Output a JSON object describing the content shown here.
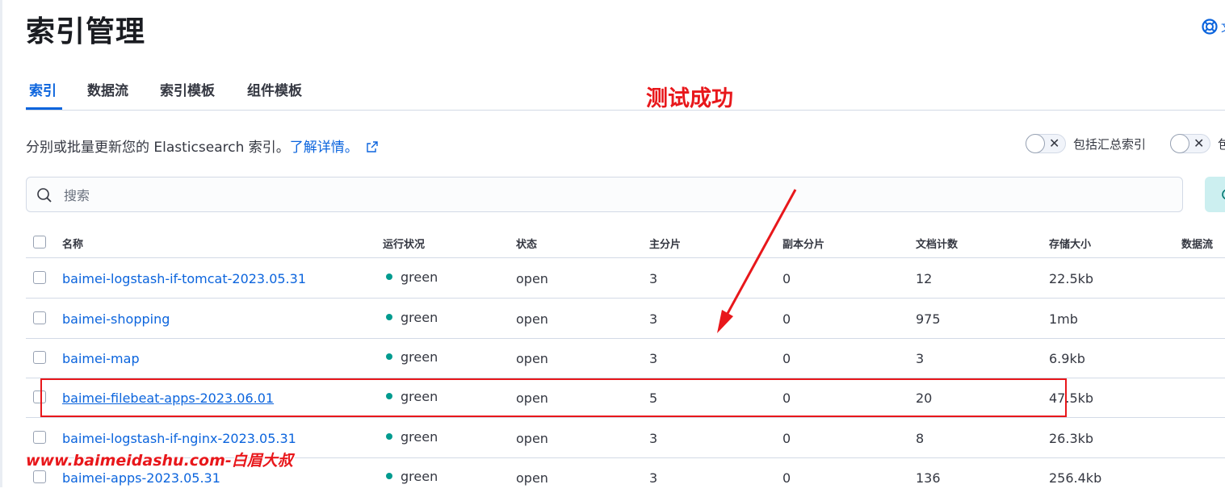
{
  "page": {
    "title": "索引管理",
    "help_text": "文"
  },
  "tabs": [
    {
      "label": "索引",
      "active": true
    },
    {
      "label": "数据流"
    },
    {
      "label": "索引模板"
    },
    {
      "label": "组件模板"
    }
  ],
  "annotation": "测试成功",
  "description": {
    "text": "分别或批量更新您的 Elasticsearch 索引。",
    "link": "了解详情。"
  },
  "toggles": [
    {
      "label": "包括汇总索引",
      "checked": false
    },
    {
      "label": "包",
      "checked": false
    }
  ],
  "search": {
    "placeholder": "搜索"
  },
  "table": {
    "columns": [
      "名称",
      "运行状况",
      "状态",
      "主分片",
      "副本分片",
      "文档计数",
      "存储大小",
      "数据流"
    ],
    "rows": [
      {
        "name": "baimei-logstash-if-tomcat-2023.05.31",
        "health": "green",
        "status": "open",
        "primary": "3",
        "replica": "0",
        "docs": "12",
        "size": "22.5kb"
      },
      {
        "name": "baimei-shopping",
        "health": "green",
        "status": "open",
        "primary": "3",
        "replica": "0",
        "docs": "975",
        "size": "1mb"
      },
      {
        "name": "baimei-map",
        "health": "green",
        "status": "open",
        "primary": "3",
        "replica": "0",
        "docs": "3",
        "size": "6.9kb"
      },
      {
        "name": "baimei-filebeat-apps-2023.06.01",
        "health": "green",
        "status": "open",
        "primary": "5",
        "replica": "0",
        "docs": "20",
        "size": "47.5kb"
      },
      {
        "name": "baimei-logstash-if-nginx-2023.05.31",
        "health": "green",
        "status": "open",
        "primary": "3",
        "replica": "0",
        "docs": "8",
        "size": "26.3kb"
      },
      {
        "name": "baimei-apps-2023.05.31",
        "health": "green",
        "status": "open",
        "primary": "3",
        "replica": "0",
        "docs": "136",
        "size": "256.4kb"
      }
    ]
  },
  "watermark": "www.baimeidashu.com-白眉大叔",
  "colors": {
    "accent": "#0b64dd",
    "health_green": "#019b8f",
    "annotation_red": "#e8171b"
  },
  "icons": [
    "help-icon",
    "external-link-icon",
    "search-icon",
    "close-icon",
    "refresh-icon"
  ]
}
